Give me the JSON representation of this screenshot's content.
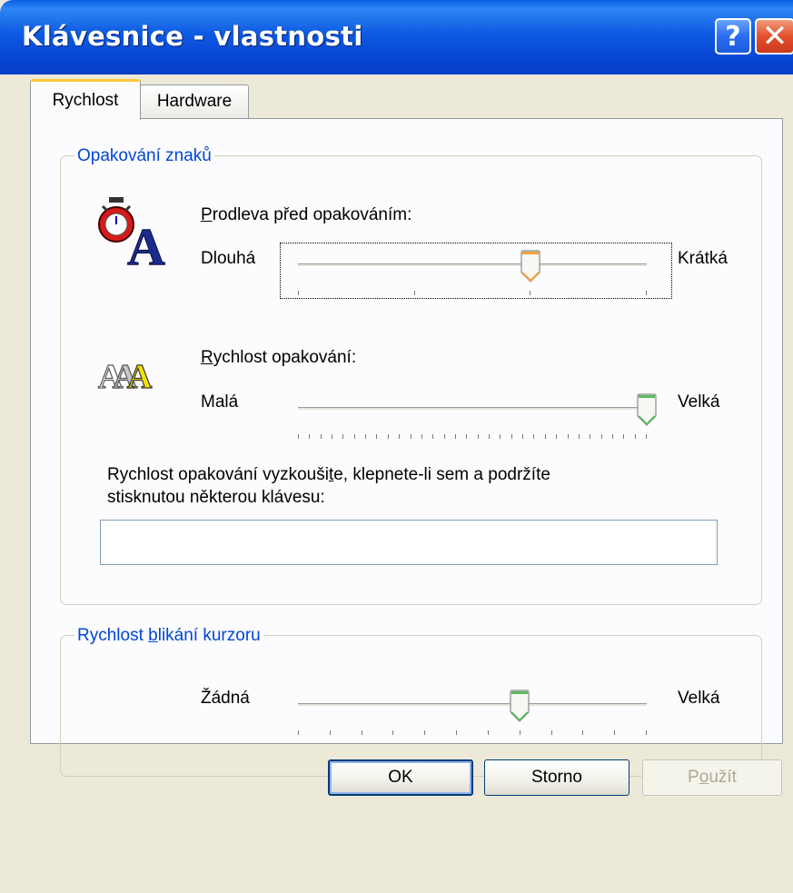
{
  "window": {
    "title": "Klávesnice - vlastnosti"
  },
  "titlebar_buttons": {
    "help": "?",
    "close": "✕"
  },
  "tabs": [
    {
      "label": "Rychlost"
    },
    {
      "label": "Hardware"
    }
  ],
  "repeat_group": {
    "title": "Opakování znaků",
    "delay": {
      "label_mnemonic": "P",
      "label_rest": "rodleva před opakováním:",
      "min_label": "Dlouhá",
      "max_label": "Krátká",
      "value_fraction": 0.667,
      "tick_count": 4
    },
    "rate": {
      "label_mnemonic": "R",
      "label_rest": "ychlost opakování:",
      "min_label": "Malá",
      "max_label": "Velká",
      "value_fraction": 1.0,
      "tick_count": 32
    },
    "test": {
      "line1_a": "Rychlost opakování vyzkouši",
      "line1_mnemonic": "t",
      "line1_b": "e, klepnete-li sem a podržíte",
      "line2": "stisknutou některou klávesu:",
      "value": ""
    }
  },
  "cursor_group": {
    "title_a": "Rychlost ",
    "title_mnemonic": "b",
    "title_b": "likání kurzoru",
    "min_label": "Žádná",
    "max_label": "Velká",
    "value_fraction": 0.636,
    "tick_count": 12
  },
  "buttons": {
    "ok": "OK",
    "cancel": "Storno",
    "apply_a": "P",
    "apply_mnemonic": "o",
    "apply_b": "užít"
  },
  "icons": {
    "delay": "stopwatch-letter-a-icon",
    "rate": "repeating-letters-a-icon",
    "help": "question-mark-icon",
    "close": "close-icon"
  },
  "colors": {
    "titlebar": "#0845d4",
    "group_title": "#0046d5",
    "tab_highlight": "#ffc83c",
    "thumb_orange": "#f0a040",
    "thumb_green": "#5cb85c"
  }
}
